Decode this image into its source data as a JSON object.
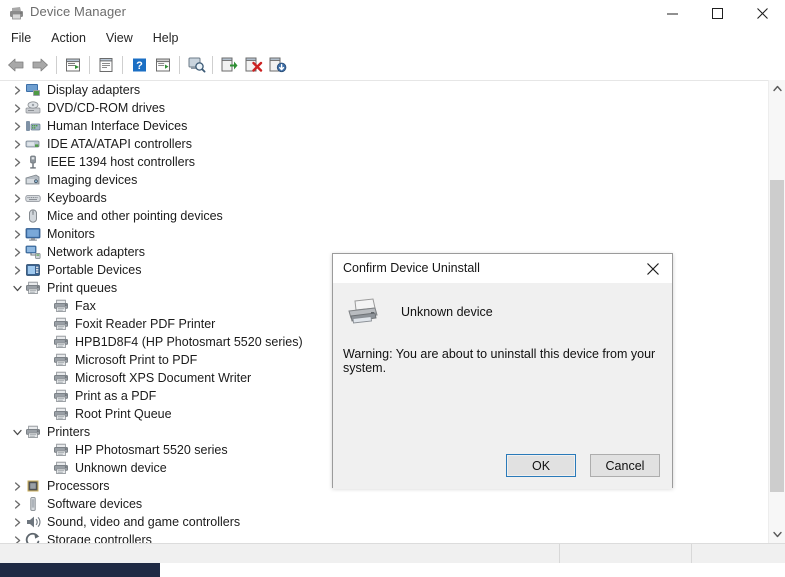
{
  "window": {
    "title": "Device Manager",
    "icon": "printer-icon",
    "controls": {
      "minimize": "Minimize",
      "maximize": "Maximize",
      "close": "Close"
    }
  },
  "menubar": {
    "items": [
      "File",
      "Action",
      "View",
      "Help"
    ]
  },
  "toolbar": {
    "buttons": [
      "back-icon",
      "forward-icon",
      "show-hidden-devices-icon",
      "properties-icon",
      "help-icon",
      "scan-for-hardware-changes-icon",
      "search-device-icon",
      "update-driver-icon",
      "uninstall-device-icon",
      "install-legacy-hardware-icon"
    ]
  },
  "tree": {
    "nodes": [
      {
        "label": "Display adapters",
        "indent": 0,
        "state": "collapsed",
        "icon": "display-adapter-icon"
      },
      {
        "label": "DVD/CD-ROM drives",
        "indent": 0,
        "state": "collapsed",
        "icon": "optical-drive-icon"
      },
      {
        "label": "Human Interface Devices",
        "indent": 0,
        "state": "collapsed",
        "icon": "hid-icon"
      },
      {
        "label": "IDE ATA/ATAPI controllers",
        "indent": 0,
        "state": "collapsed",
        "icon": "ide-controller-icon"
      },
      {
        "label": "IEEE 1394 host controllers",
        "indent": 0,
        "state": "collapsed",
        "icon": "firewire-icon"
      },
      {
        "label": "Imaging devices",
        "indent": 0,
        "state": "collapsed",
        "icon": "camera-icon"
      },
      {
        "label": "Keyboards",
        "indent": 0,
        "state": "collapsed",
        "icon": "keyboard-icon"
      },
      {
        "label": "Mice and other pointing devices",
        "indent": 0,
        "state": "collapsed",
        "icon": "mouse-icon"
      },
      {
        "label": "Monitors",
        "indent": 0,
        "state": "collapsed",
        "icon": "monitor-icon"
      },
      {
        "label": "Network adapters",
        "indent": 0,
        "state": "collapsed",
        "icon": "network-icon"
      },
      {
        "label": "Portable Devices",
        "indent": 0,
        "state": "collapsed",
        "icon": "portable-device-icon"
      },
      {
        "label": "Print queues",
        "indent": 0,
        "state": "expanded",
        "icon": "printer-icon"
      },
      {
        "label": "Fax",
        "indent": 1,
        "state": "leaf",
        "icon": "printer-icon"
      },
      {
        "label": "Foxit Reader PDF Printer",
        "indent": 1,
        "state": "leaf",
        "icon": "printer-icon"
      },
      {
        "label": "HPB1D8F4 (HP Photosmart 5520 series)",
        "indent": 1,
        "state": "leaf",
        "icon": "printer-icon"
      },
      {
        "label": "Microsoft Print to PDF",
        "indent": 1,
        "state": "leaf",
        "icon": "printer-icon"
      },
      {
        "label": "Microsoft XPS Document Writer",
        "indent": 1,
        "state": "leaf",
        "icon": "printer-icon"
      },
      {
        "label": "Print as a PDF",
        "indent": 1,
        "state": "leaf",
        "icon": "printer-icon"
      },
      {
        "label": "Root Print Queue",
        "indent": 1,
        "state": "leaf",
        "icon": "printer-icon"
      },
      {
        "label": "Printers",
        "indent": 0,
        "state": "expanded",
        "icon": "printer-icon"
      },
      {
        "label": "HP Photosmart 5520 series",
        "indent": 1,
        "state": "leaf",
        "icon": "printer-icon"
      },
      {
        "label": "Unknown device",
        "indent": 1,
        "state": "leaf",
        "icon": "printer-icon"
      },
      {
        "label": "Processors",
        "indent": 0,
        "state": "collapsed",
        "icon": "processor-icon"
      },
      {
        "label": "Software devices",
        "indent": 0,
        "state": "collapsed",
        "icon": "software-device-icon"
      },
      {
        "label": "Sound, video and game controllers",
        "indent": 0,
        "state": "collapsed",
        "icon": "speaker-icon"
      },
      {
        "label": "Storage controllers",
        "indent": 0,
        "state": "collapsed",
        "icon": "storage-controller-icon"
      }
    ]
  },
  "annotation": {
    "type": "arrow",
    "direction": "left",
    "color": "#e8607a",
    "points_to": "Unknown device"
  },
  "scrollbar": {
    "up": "scroll-up",
    "down": "scroll-down"
  },
  "statusbar": {
    "pane1": "",
    "pane2": "",
    "pane3": ""
  },
  "dialog": {
    "title": "Confirm Device Uninstall",
    "close_label": "Close",
    "device_icon": "printer-icon",
    "device_name": "Unknown device",
    "warning": "Warning: You are about to uninstall this device from your system.",
    "ok_label": "OK",
    "cancel_label": "Cancel"
  },
  "colors": {
    "accent_focus": "#2a7ab9",
    "annotation": "#e8607a",
    "taskbar": "#1f2a44",
    "dialog_bg": "#f0f0f0"
  }
}
